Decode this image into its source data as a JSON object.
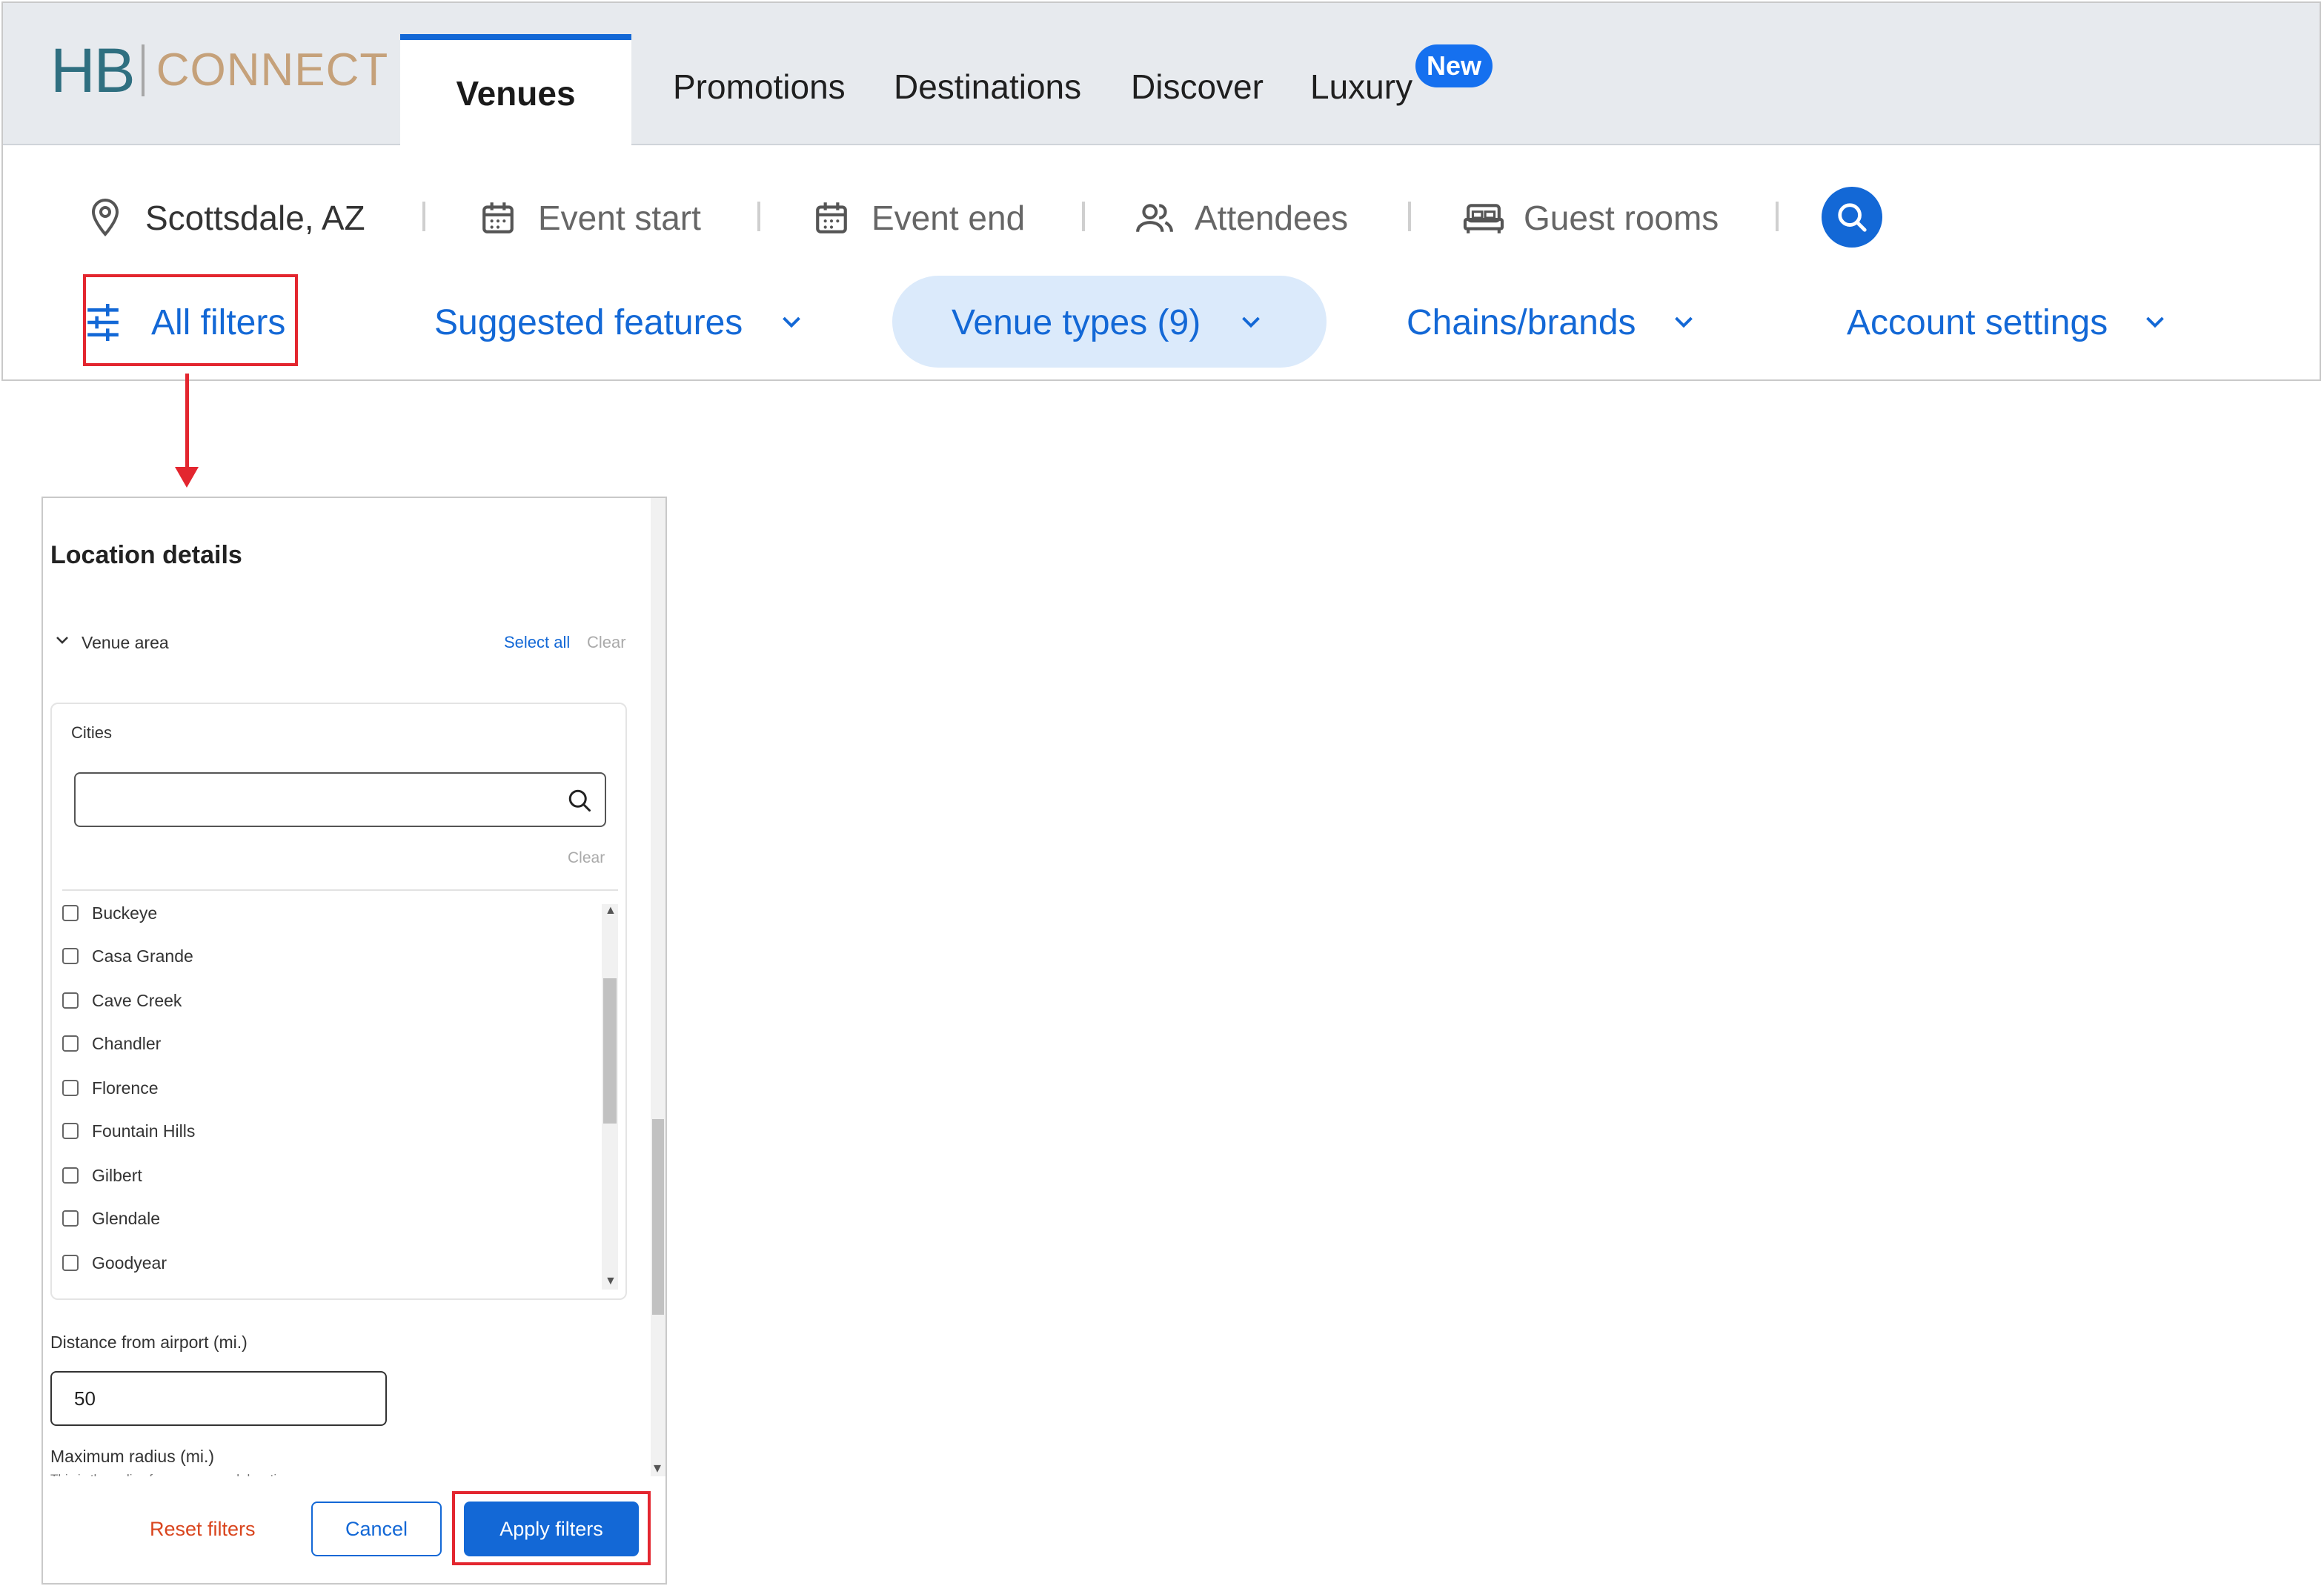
{
  "header": {
    "logo": {
      "left": "HB",
      "right": "CONNECT"
    },
    "tabs": [
      {
        "label": "Venues",
        "active": true
      },
      {
        "label": "Promotions"
      },
      {
        "label": "Destinations"
      },
      {
        "label": "Discover"
      },
      {
        "label": "Luxury",
        "badge": "New"
      }
    ]
  },
  "search": {
    "location": "Scottsdale, AZ",
    "event_start": "Event start",
    "event_end": "Event end",
    "attendees": "Attendees",
    "guest_rooms": "Guest rooms"
  },
  "filters": {
    "all_filters": "All filters",
    "suggested_features": "Suggested features",
    "venue_types": "Venue types (9)",
    "chains_brands": "Chains/brands",
    "account_settings": "Account settings"
  },
  "panel": {
    "title": "Location details",
    "venue_area": {
      "label": "Venue area",
      "select_all": "Select all",
      "clear": "Clear"
    },
    "cities": {
      "label": "Cities",
      "search_value": "",
      "clear": "Clear",
      "items": [
        "Buckeye",
        "Casa Grande",
        "Cave Creek",
        "Chandler",
        "Florence",
        "Fountain Hills",
        "Gilbert",
        "Glendale",
        "Goodyear"
      ]
    },
    "distance_from_airport": {
      "label": "Distance from airport (mi.)",
      "value": "50"
    },
    "maximum_radius": {
      "label": "Maximum radius (mi.)",
      "sublabel": "This is the radius from your search location"
    },
    "footer": {
      "reset": "Reset filters",
      "cancel": "Cancel",
      "apply": "Apply filters"
    }
  },
  "colors": {
    "accent": "#1368d6",
    "highlight": "#e3262f",
    "reset": "#d9451e",
    "logo_hb": "#2f6f80",
    "logo_connect": "#c5a17a"
  }
}
